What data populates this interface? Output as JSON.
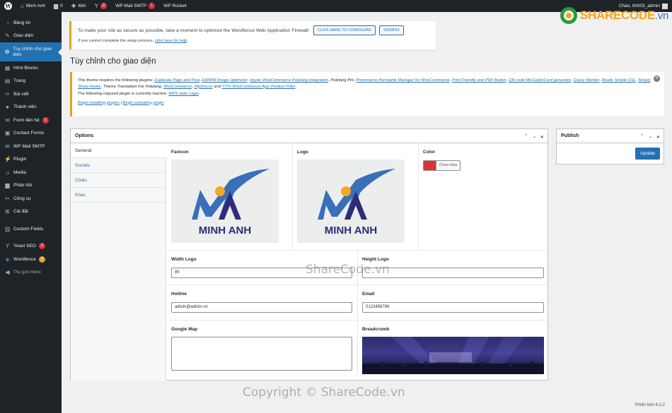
{
  "adminbar": {
    "site_name": "Minh Anh",
    "comments_count": "0",
    "new_label": "Mới",
    "yoast_badge": "2",
    "smtp_label": "WP Mail SMTP",
    "smtp_badge": "!",
    "rocket_label": "WP Rocket",
    "greeting": "Chào, lth003_admin"
  },
  "sidebar": {
    "items": [
      {
        "label": "Bảng tin",
        "icon": "dashboard-icon"
      },
      {
        "label": "Giao diện",
        "icon": "appearance-icon"
      },
      {
        "label": "Tùy chỉnh cho giao diện",
        "icon": "gear-icon"
      },
      {
        "label": "Html Blocks",
        "icon": "blocks-icon"
      },
      {
        "label": "Trang",
        "icon": "page-icon"
      },
      {
        "label": "Bài viết",
        "icon": "pin-icon"
      },
      {
        "label": "Thành viên",
        "icon": "users-icon"
      },
      {
        "label": "Form liên hệ",
        "icon": "mail-icon",
        "badge": "1"
      },
      {
        "label": "Contact Forms",
        "icon": "forms-icon"
      },
      {
        "label": "WP Mail SMTP",
        "icon": "smtp-icon"
      },
      {
        "label": "Plugin",
        "icon": "plugin-icon"
      },
      {
        "label": "Media",
        "icon": "media-icon"
      },
      {
        "label": "Phản hồi",
        "icon": "comment-icon"
      },
      {
        "label": "Công cụ",
        "icon": "tools-icon"
      },
      {
        "label": "Cài đặt",
        "icon": "settings-icon"
      },
      {
        "label": "Custom Fields",
        "icon": "fields-icon"
      },
      {
        "label": "Yoast SEO",
        "icon": "yoast-icon",
        "badge": "2"
      },
      {
        "label": "Wordfence",
        "icon": "wordfence-icon",
        "badge": "2"
      },
      {
        "label": "Thu gọn menu",
        "icon": "collapse-icon"
      }
    ]
  },
  "wordfence_notice": {
    "text": "To make your site as secure as possible, take a moment to optimize the Wordfence Web Application Firewall:",
    "configure_button": "CLICK HERE TO CONFIGURE",
    "dismiss_button": "DISMISS",
    "help_prefix": "If you cannot complete the setup process, ",
    "help_link": "click here for help",
    "help_suffix": "."
  },
  "page": {
    "title": "Tùy chỉnh cho giao diện"
  },
  "tgm_notice": {
    "intro": "This theme requires the following plugins: ",
    "plugins": [
      "Duplicate Page and Post",
      "EWWW Image Optimizer",
      "Hyyan WooCommerce Polylang Integration",
      "Polylang Pro",
      "Premmerce Permalink Manager for WooCommerce",
      "Print Friendly and PDF Button",
      "QR code MeCard/vCard generator",
      "Query Monitor",
      "Really Simple SSL",
      "Simply Show Hooks",
      "Theme Translation For Polylang",
      "WooCommerce",
      "WpDiscuz",
      "YITH WooCommerce Ajax Product Filter"
    ],
    "inactive_intro": "The following required plugin is currently inactive: ",
    "inactive_plugin": "WPS Hide Login",
    "begin_installing": "Begin installing plugins",
    "separator": "|",
    "begin_activating": "Begin activating plugin"
  },
  "options": {
    "title": "Options",
    "tabs": [
      "General",
      "Socials",
      "Chats",
      "Khác"
    ],
    "favicon_label": "Favicon",
    "logo_label": "Logo",
    "color_label": "Color",
    "color_value": "#dd3333",
    "color_button": "Chọn màu",
    "logo_text": "MINH ANH",
    "width_logo_label": "Width Logo",
    "width_logo_value": "85",
    "height_logo_label": "Height Logo",
    "height_logo_value": "",
    "hotline_label": "Hotline",
    "hotline_value": "admin@admin.vn",
    "email_label": "Email",
    "email_value": "0123456789",
    "google_map_label": "Google Map",
    "breadcrumb_label": "Breadcrumb"
  },
  "publish": {
    "title": "Publish",
    "update_button": "Update"
  },
  "footer": {
    "version": "Phiên bản 6.2.2"
  },
  "watermarks": {
    "logo": "SHARECODE",
    "logo_suffix": ".vn",
    "middle": "ShareCode.vn",
    "bottom": "Copyright © ShareCode.vn"
  },
  "colors": {
    "accent": "#2271b1",
    "sidebar_bg": "#1d2327",
    "notice_border": "#dba617",
    "badge": "#d63638"
  }
}
